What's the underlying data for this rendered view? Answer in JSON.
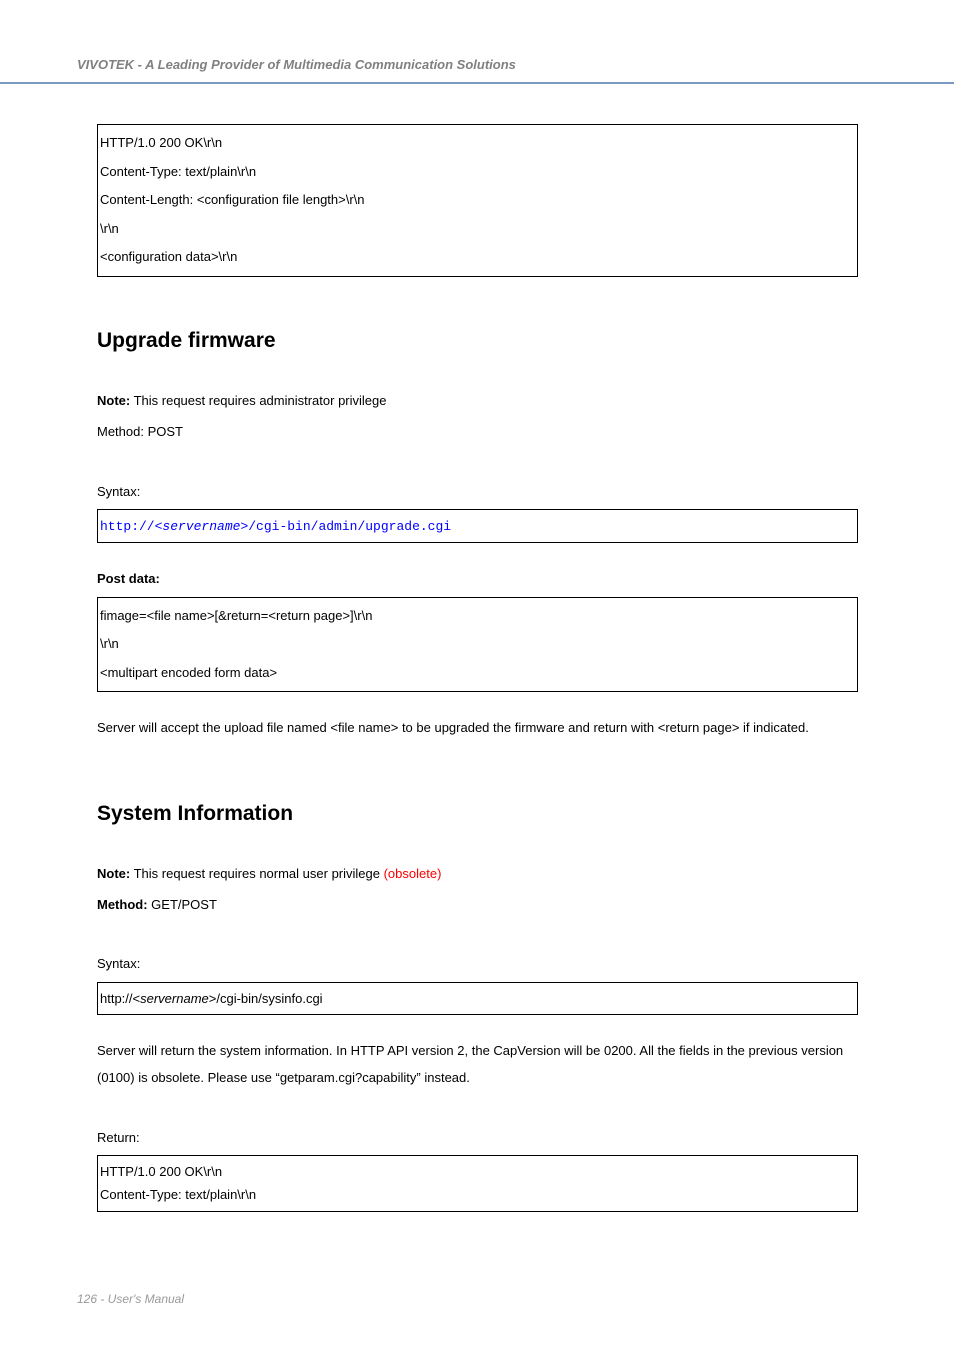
{
  "header": "VIVOTEK - A Leading Provider of Multimedia Communication Solutions",
  "response1": {
    "l1": "HTTP/1.0 200 OK\\r\\n",
    "l2": "Content-Type: text/plain\\r\\n",
    "l3": "Content-Length: <configuration file length>\\r\\n",
    "l4": "\\r\\n",
    "l5": "<configuration data>\\r\\n"
  },
  "upgrade": {
    "title": "Upgrade firmware",
    "note_bold": "Note:",
    "note_text": " This request requires administrator privilege",
    "method": "Method: POST",
    "syntax_label": "Syntax:",
    "url_p1": "http://<",
    "url_p2": "servername",
    "url_p3": ">/cgi-bin/admin/upgrade.cgi",
    "post_label": "Post data:",
    "post_l1": "fimage=<file name>[&return=<return page>]\\r\\n",
    "post_l2": "\\r\\n",
    "post_l3": "<multipart encoded form data>",
    "desc": "Server will accept the upload file named <file name> to be upgraded the firmware and return with <return page> if indicated."
  },
  "sysinfo": {
    "title": "System Information",
    "note_bold": "Note:",
    "note_text": " This request requires normal user privilege ",
    "obsolete": "(obsolete)",
    "method_bold": "Method:",
    "method_text": " GET/POST",
    "syntax_label": "Syntax:",
    "url_p1": "http://<",
    "url_p2": "servername",
    "url_p3": ">/cgi-bin/sysinfo.cgi",
    "desc": "Server will return the system information. In HTTP API version 2, the CapVersion will be 0200. All the fields in the previous version (0100) is obsolete. Please use “getparam.cgi?capability” instead.",
    "return_label": "Return:",
    "ret_l1": "HTTP/1.0 200 OK\\r\\n",
    "ret_l2": "Content-Type: text/plain\\r\\n"
  },
  "footer": "126 - User's Manual"
}
